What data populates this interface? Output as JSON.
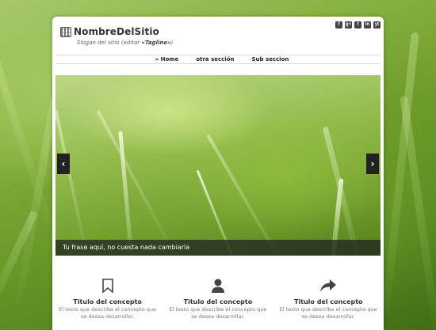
{
  "site": {
    "name": "NombreDelSitio",
    "tagline_pre": "Slogan del sitio (editar ",
    "tagline_bold": "«Tagline»",
    "tagline_post": ")"
  },
  "social": [
    "f",
    "g+",
    "t",
    "in",
    "yt"
  ],
  "nav": {
    "items": [
      {
        "label": "» Home"
      },
      {
        "label": "otra sección"
      },
      {
        "label": "Sub seccion"
      }
    ]
  },
  "slider": {
    "caption": "Tu frase aquí, no cuesta nada cambiarla",
    "prev": "‹",
    "next": "›"
  },
  "features": [
    {
      "icon": "bookmark-icon",
      "title": "Titulo del concepto",
      "text": "El texto que describe el concepto que se desea desarrollar."
    },
    {
      "icon": "user-icon",
      "title": "Titulo del concepto",
      "text": "El texto que describe el concepto que se desea desarrollar."
    },
    {
      "icon": "share-arrow-icon",
      "title": "Titulo del concepto",
      "text": "El texto que describe el concepto que se desea desarrollar."
    }
  ]
}
